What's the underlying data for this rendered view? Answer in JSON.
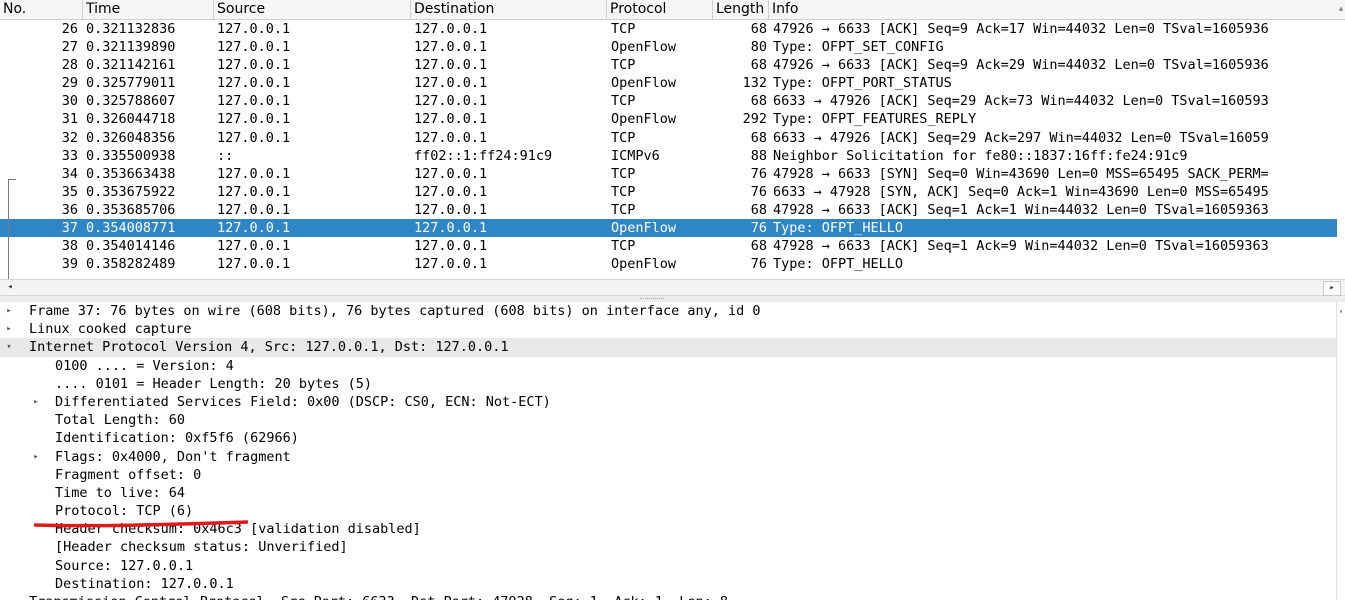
{
  "columns": [
    "No.",
    "Time",
    "Source",
    "Destination",
    "Protocol",
    "Length",
    "Info"
  ],
  "packets": [
    {
      "no": "26",
      "time": "0.321132836",
      "src": "127.0.0.1",
      "dst": "127.0.0.1",
      "proto": "TCP",
      "len": "68",
      "info": "47926 → 6633 [ACK] Seq=9 Ack=17 Win=44032 Len=0 TSval=1605936"
    },
    {
      "no": "27",
      "time": "0.321139890",
      "src": "127.0.0.1",
      "dst": "127.0.0.1",
      "proto": "OpenFlow",
      "len": "80",
      "info": "Type: OFPT_SET_CONFIG"
    },
    {
      "no": "28",
      "time": "0.321142161",
      "src": "127.0.0.1",
      "dst": "127.0.0.1",
      "proto": "TCP",
      "len": "68",
      "info": "47926 → 6633 [ACK] Seq=9 Ack=29 Win=44032 Len=0 TSval=1605936"
    },
    {
      "no": "29",
      "time": "0.325779011",
      "src": "127.0.0.1",
      "dst": "127.0.0.1",
      "proto": "OpenFlow",
      "len": "132",
      "info": "Type: OFPT_PORT_STATUS"
    },
    {
      "no": "30",
      "time": "0.325788607",
      "src": "127.0.0.1",
      "dst": "127.0.0.1",
      "proto": "TCP",
      "len": "68",
      "info": "6633 → 47926 [ACK] Seq=29 Ack=73 Win=44032 Len=0 TSval=160593"
    },
    {
      "no": "31",
      "time": "0.326044718",
      "src": "127.0.0.1",
      "dst": "127.0.0.1",
      "proto": "OpenFlow",
      "len": "292",
      "info": "Type: OFPT_FEATURES_REPLY"
    },
    {
      "no": "32",
      "time": "0.326048356",
      "src": "127.0.0.1",
      "dst": "127.0.0.1",
      "proto": "TCP",
      "len": "68",
      "info": "6633 → 47926 [ACK] Seq=29 Ack=297 Win=44032 Len=0 TSval=16059"
    },
    {
      "no": "33",
      "time": "0.335500938",
      "src": "::",
      "dst": "ff02::1:ff24:91c9",
      "proto": "ICMPv6",
      "len": "88",
      "info": "Neighbor Solicitation for fe80::1837:16ff:fe24:91c9"
    },
    {
      "no": "34",
      "time": "0.353663438",
      "src": "127.0.0.1",
      "dst": "127.0.0.1",
      "proto": "TCP",
      "len": "76",
      "info": "47928 → 6633 [SYN] Seq=0 Win=43690 Len=0 MSS=65495 SACK_PERM="
    },
    {
      "no": "35",
      "time": "0.353675922",
      "src": "127.0.0.1",
      "dst": "127.0.0.1",
      "proto": "TCP",
      "len": "76",
      "info": "6633 → 47928 [SYN, ACK] Seq=0 Ack=1 Win=43690 Len=0 MSS=65495"
    },
    {
      "no": "36",
      "time": "0.353685706",
      "src": "127.0.0.1",
      "dst": "127.0.0.1",
      "proto": "TCP",
      "len": "68",
      "info": "47928 → 6633 [ACK] Seq=1 Ack=1 Win=44032 Len=0 TSval=16059363"
    },
    {
      "no": "37",
      "time": "0.354008771",
      "src": "127.0.0.1",
      "dst": "127.0.0.1",
      "proto": "OpenFlow",
      "len": "76",
      "info": "Type: OFPT_HELLO",
      "selected": true
    },
    {
      "no": "38",
      "time": "0.354014146",
      "src": "127.0.0.1",
      "dst": "127.0.0.1",
      "proto": "TCP",
      "len": "68",
      "info": "47928 → 6633 [ACK] Seq=1 Ack=9 Win=44032 Len=0 TSval=16059363"
    },
    {
      "no": "39",
      "time": "0.358282489",
      "src": "127.0.0.1",
      "dst": "127.0.0.1",
      "proto": "OpenFlow",
      "len": "76",
      "info": "Type: OFPT_HELLO"
    }
  ],
  "details": [
    {
      "level": 0,
      "expander": "collapsed",
      "text": "Frame 37: 76 bytes on wire (608 bits), 76 bytes captured (608 bits) on interface any, id 0"
    },
    {
      "level": 0,
      "expander": "collapsed",
      "text": "Linux cooked capture"
    },
    {
      "level": 0,
      "expander": "expanded",
      "text": "Internet Protocol Version 4, Src: 127.0.0.1, Dst: 127.0.0.1",
      "highlight": true
    },
    {
      "level": 1,
      "expander": "none",
      "text": "0100 .... = Version: 4"
    },
    {
      "level": 1,
      "expander": "none",
      "text": ".... 0101 = Header Length: 20 bytes (5)"
    },
    {
      "level": 1,
      "expander": "collapsed",
      "text": "Differentiated Services Field: 0x00 (DSCP: CS0, ECN: Not-ECT)"
    },
    {
      "level": 1,
      "expander": "none",
      "text": "Total Length: 60"
    },
    {
      "level": 1,
      "expander": "none",
      "text": "Identification: 0xf5f6 (62966)"
    },
    {
      "level": 1,
      "expander": "collapsed",
      "text": "Flags: 0x4000, Don't fragment"
    },
    {
      "level": 1,
      "expander": "none",
      "text": "Fragment offset: 0"
    },
    {
      "level": 1,
      "expander": "none",
      "text": "Time to live: 64"
    },
    {
      "level": 1,
      "expander": "none",
      "text": "Protocol: TCP (6)"
    },
    {
      "level": 1,
      "expander": "none",
      "text": "Header checksum: 0x46c3 [validation disabled]"
    },
    {
      "level": 1,
      "expander": "none",
      "text": "[Header checksum status: Unverified]"
    },
    {
      "level": 1,
      "expander": "none",
      "text": "Source: 127.0.0.1"
    },
    {
      "level": 1,
      "expander": "none",
      "text": "Destination: 127.0.0.1"
    },
    {
      "level": 0,
      "expander": "collapsed",
      "text": "Transmission Control Protocol, Src Port: 6633, Dst Port: 47928, Seq: 1, Ack: 1, Len: 8"
    }
  ],
  "icons": {
    "collapsed": "▸",
    "expanded": "▾",
    "scroll_left": "◂",
    "scroll_right": "▸",
    "scroll_up": "▴"
  },
  "colors": {
    "selection": "#2f86c6",
    "annotation": "#e0191b",
    "highlight_row": "#e9e9e9"
  }
}
